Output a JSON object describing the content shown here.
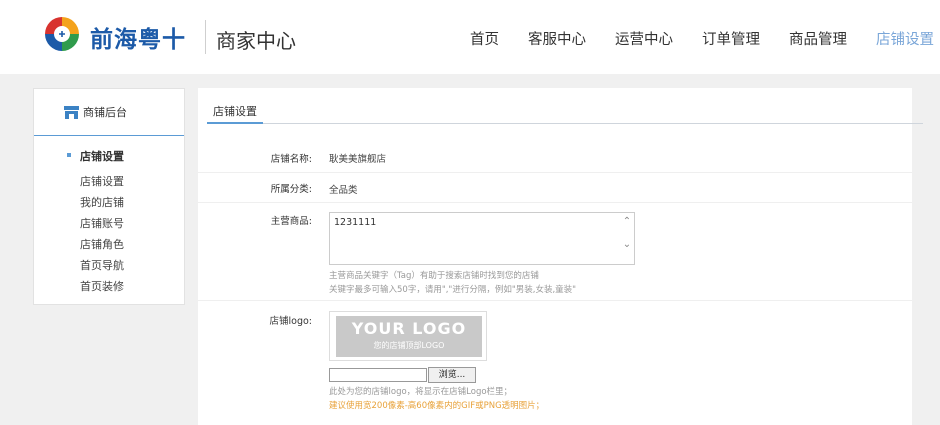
{
  "header": {
    "brand_name": "前海粤十",
    "brand_sub": "商家中心",
    "nav": [
      {
        "label": "首页"
      },
      {
        "label": "客服中心"
      },
      {
        "label": "运营中心"
      },
      {
        "label": "订单管理"
      },
      {
        "label": "商品管理"
      },
      {
        "label": "店铺设置",
        "active": true
      }
    ],
    "active_color": "#7aa6d8"
  },
  "sidebar": {
    "title": "商铺后台",
    "title_icon": "store-icon",
    "group": "店铺设置",
    "items": [
      "店铺设置",
      "我的店铺",
      "店铺账号",
      "店铺角色",
      "首页导航",
      "首页装修"
    ],
    "accent": "#5b9bd5"
  },
  "content": {
    "tab": "店铺设置",
    "fields": {
      "store_name_label": "店铺名称:",
      "store_name_value": "耿美美旗舰店",
      "category_label": "所属分类:",
      "category_value": "全品类",
      "main_goods_label": "主营商品:",
      "main_goods_value": "1231111",
      "main_goods_hint_1": "主营商品关键字（Tag）有助于搜索店铺时找到您的店铺",
      "main_goods_hint_2": "关键字最多可输入50字，请用\",\"进行分隔，例如\"男装,女装,童装\"",
      "logo_label": "店铺logo:",
      "logo_preview_big": "YOUR LOGO",
      "logo_preview_small": "您的店铺顶部LOGO",
      "browse_label": "浏览...",
      "logo_hint_1": "此处为您的店铺logo，将显示在店铺Logo栏里；",
      "logo_hint_2": "建议使用宽200像素-高60像素内的GIF或PNG透明图片；"
    }
  }
}
